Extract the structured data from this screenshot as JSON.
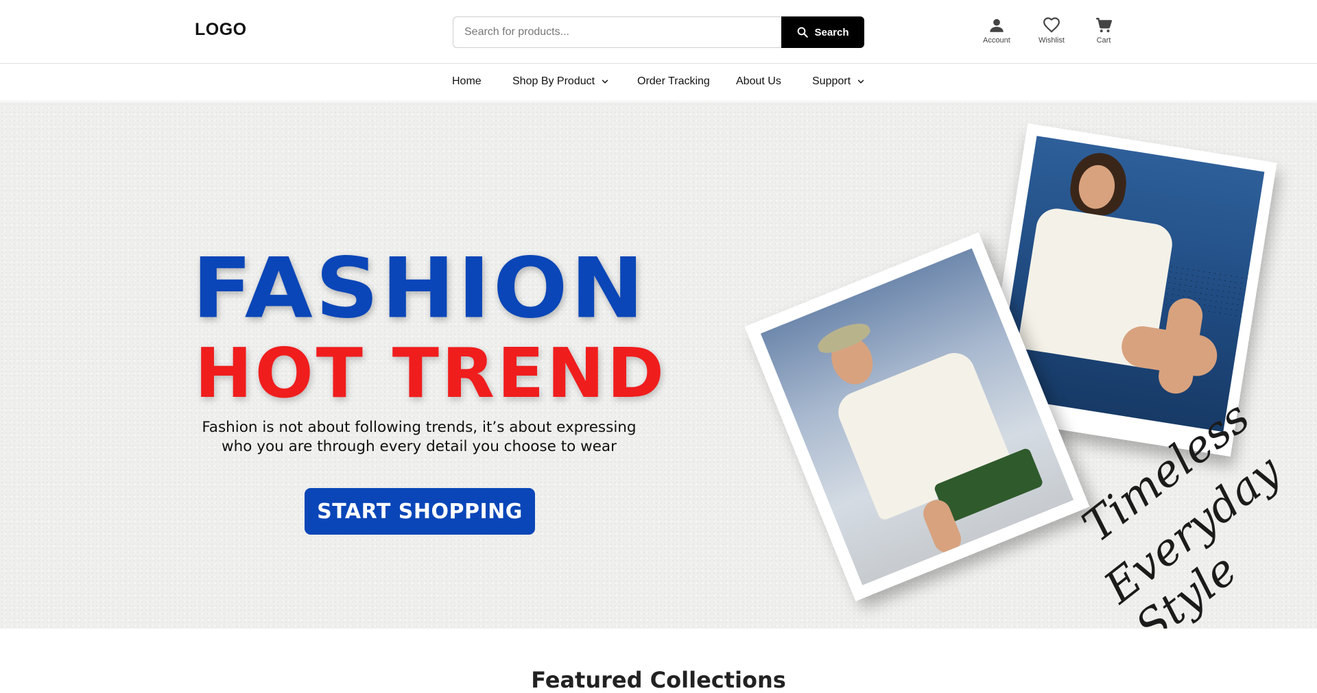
{
  "header": {
    "logo": "LOGO",
    "search": {
      "placeholder": "Search for products...",
      "button_label": "Search"
    },
    "icons": [
      {
        "icon": "account-icon",
        "label": "Account"
      },
      {
        "icon": "heart-icon",
        "label": "Wishlist"
      },
      {
        "icon": "cart-icon",
        "label": "Cart"
      }
    ]
  },
  "nav": {
    "items": [
      {
        "label": "Home",
        "dropdown": false
      },
      {
        "label": "Shop By Product",
        "dropdown": true
      },
      {
        "label": "Order Tracking",
        "dropdown": false
      },
      {
        "label": "About Us",
        "dropdown": false
      },
      {
        "label": "Support",
        "dropdown": true
      }
    ]
  },
  "hero": {
    "headline_1": "FASHION",
    "headline_2": "HOT TREND",
    "subtitle": "Fashion is not about following trends, it’s about expressing who you are through every detail you choose to wear",
    "cta_label": "START SHOPPING",
    "tagline_1": "Timeless",
    "tagline_2": "Everyday Style",
    "colors": {
      "primary_blue": "#0a46b8",
      "accent_red": "#f01d1d"
    }
  },
  "featured": {
    "title": "Featured Collections"
  }
}
